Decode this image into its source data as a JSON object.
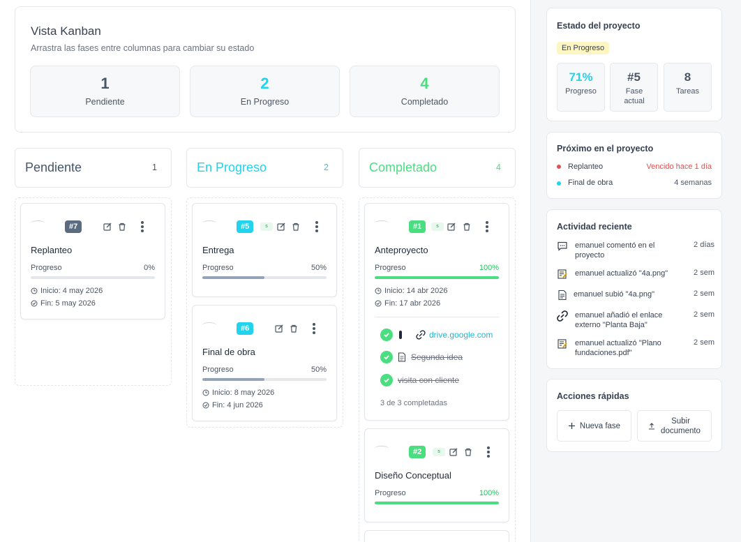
{
  "header": {
    "title": "Vista Kanban",
    "subtitle": "Arrastra las fases entre columnas para cambiar su estado",
    "stats": [
      {
        "value": "1",
        "label": "Pendiente",
        "color": "#475569"
      },
      {
        "value": "2",
        "label": "En Progreso",
        "color": "#22d3ee"
      },
      {
        "value": "4",
        "label": "Completado",
        "color": "#4ade80"
      }
    ]
  },
  "columns": [
    {
      "title": "Pendiente",
      "count": "1",
      "color": "#475569"
    },
    {
      "title": "En Progreso",
      "count": "2",
      "color": "#22d3ee"
    },
    {
      "title": "Completado",
      "count": "4",
      "color": "#4ade80"
    }
  ],
  "cards": {
    "replanteo": {
      "number": "#7",
      "title": "Replanteo",
      "progress_label": "Progreso",
      "progress_text": "0%",
      "progress": 0,
      "start": "Inicio: 4 may 2026",
      "end": "Fin: 5 may 2026"
    },
    "entrega": {
      "number": "#5",
      "title": "Entrega",
      "progress_label": "Progreso",
      "progress_text": "50%",
      "progress": 50
    },
    "final": {
      "number": "#6",
      "title": "Final de obra",
      "progress_label": "Progreso",
      "progress_text": "50%",
      "progress": 50,
      "start": "Inicio: 8 may 2026",
      "end": "Fin: 4 jun 2026"
    },
    "anteproyecto": {
      "number": "#1",
      "title": "Anteproyecto",
      "progress_label": "Progreso",
      "progress_text": "100%",
      "progress": 100,
      "start": "Inicio: 14 abr 2026",
      "end": "Fin: 17 abr 2026",
      "checklist": [
        {
          "icon": "link-icon",
          "text": "drive.google.com",
          "style": "link"
        },
        {
          "icon": "document-icon",
          "text": "Segunda idea",
          "style": "done"
        },
        {
          "icon": "",
          "text": "visita con cliente",
          "style": "done"
        }
      ],
      "checklist_summary": "3 de 3 completadas"
    },
    "diseno": {
      "number": "#2",
      "title": "Diseño Conceptual",
      "progress_label": "Progreso",
      "progress_text": "100%",
      "progress": 100
    }
  },
  "sidebar": {
    "estado": {
      "title": "Estado del proyecto",
      "badge": "En Progreso",
      "stats": [
        {
          "value": "71%",
          "label": "Progreso",
          "color": "#22d3ee"
        },
        {
          "value": "#5",
          "label": "Fase actual",
          "color": "#4b5563"
        },
        {
          "value": "8",
          "label": "Tareas",
          "color": "#4b5563"
        }
      ]
    },
    "proximo": {
      "title": "Próximo en el proyecto",
      "items": [
        {
          "name": "Replanteo",
          "when": "Vencido hace 1 día",
          "dot": "#e05252",
          "when_color": "#e05252"
        },
        {
          "name": "Final de obra",
          "when": "4 semanas",
          "dot": "#22d3ee",
          "when_color": "#4b5563"
        }
      ]
    },
    "actividad": {
      "title": "Actividad reciente",
      "items": [
        {
          "icon": "comment-icon",
          "text": "emanuel comentó en el proyecto",
          "when": "2 días"
        },
        {
          "icon": "edit-note-icon",
          "text": "emanuel actualizó \"4a.png\"",
          "when": "2 sem"
        },
        {
          "icon": "document-icon",
          "text": "emanuel subió \"4a.png\"",
          "when": "2 sem"
        },
        {
          "icon": "link-icon",
          "text": "emanuel añadió el enlace externo \"Planta Baja\"",
          "when": "2 sem"
        },
        {
          "icon": "edit-note-icon",
          "text": "emanuel actualizó \"Plano fundaciones.pdf\"",
          "when": "2 sem"
        }
      ]
    },
    "acciones": {
      "title": "Acciones rápidas",
      "nueva_fase": "Nueva fase",
      "subir": "Subir documento"
    }
  }
}
